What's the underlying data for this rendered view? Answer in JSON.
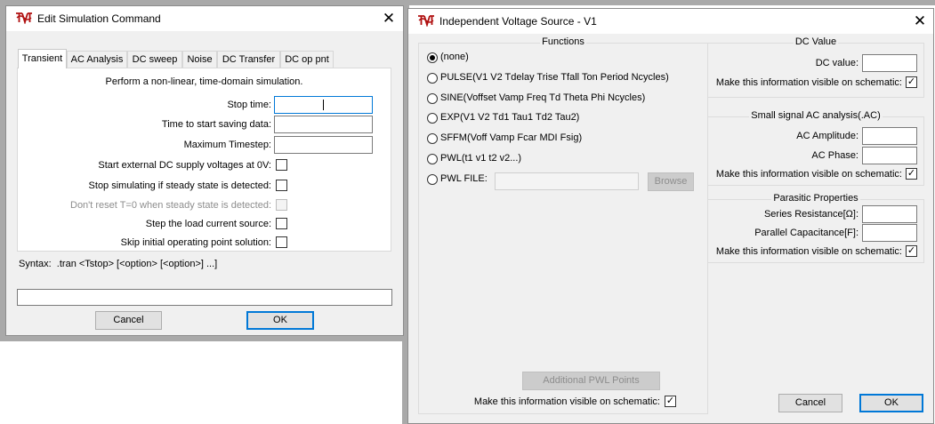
{
  "sim_dialog": {
    "title": "Edit Simulation Command",
    "tabs": [
      "Transient",
      "AC Analysis",
      "DC sweep",
      "Noise",
      "DC Transfer",
      "DC op pnt"
    ],
    "description": "Perform a non-linear, time-domain simulation.",
    "fields": {
      "stop_time": {
        "label": "Stop time:",
        "value": ""
      },
      "start_saving": {
        "label": "Time to start saving data:",
        "value": ""
      },
      "max_timestep": {
        "label": "Maximum Timestep:",
        "value": ""
      }
    },
    "options": {
      "start_ext_dc": {
        "label": "Start external DC supply voltages at 0V:",
        "checked": false
      },
      "stop_steady": {
        "label": "Stop simulating if steady state is detected:",
        "checked": false
      },
      "dont_reset": {
        "label": "Don't reset T=0 when steady state is detected:",
        "checked": false
      },
      "step_load": {
        "label": "Step the load current source:",
        "checked": false
      },
      "skip_op": {
        "label": "Skip initial operating point solution:",
        "checked": false
      }
    },
    "syntax": "Syntax:  .tran <Tstop> [<option> [<option>] ...]",
    "command_value": "",
    "cancel_label": "Cancel",
    "ok_label": "OK"
  },
  "vs_dialog": {
    "title": "Independent Voltage Source - V1",
    "functions": {
      "title": "Functions",
      "options": [
        {
          "label": "(none)",
          "selected": true
        },
        {
          "label": "PULSE(V1 V2 Tdelay Trise Tfall Ton Period Ncycles)",
          "selected": false
        },
        {
          "label": "SINE(Voffset Vamp Freq Td Theta Phi Ncycles)",
          "selected": false
        },
        {
          "label": "EXP(V1 V2 Td1 Tau1 Td2 Tau2)",
          "selected": false
        },
        {
          "label": "SFFM(Voff Vamp Fcar MDI Fsig)",
          "selected": false
        },
        {
          "label": "PWL(t1 v1 t2 v2...)",
          "selected": false
        },
        {
          "label": "PWL FILE:",
          "selected": false
        }
      ],
      "pwl_file_value": "",
      "browse_label": "Browse",
      "additional_pwl_label": "Additional PWL Points",
      "visible_label": "Make this information visible on schematic:",
      "visible_checked": true
    },
    "dc_value": {
      "title": "DC Value",
      "dc_label": "DC value:",
      "dc_value": "",
      "visible_label": "Make this information visible on schematic:",
      "visible_checked": true
    },
    "small_signal": {
      "title": "Small signal AC analysis(.AC)",
      "amp_label": "AC Amplitude:",
      "amp_value": "",
      "phase_label": "AC Phase:",
      "phase_value": "",
      "visible_label": "Make this information visible on schematic:",
      "visible_checked": true
    },
    "parasitic": {
      "title": "Parasitic Properties",
      "series_label": "Series Resistance[Ω]:",
      "series_value": "",
      "cap_label": "Parallel Capacitance[F]:",
      "cap_value": "",
      "visible_label": "Make this information visible on schematic:",
      "visible_checked": true
    },
    "cancel_label": "Cancel",
    "ok_label": "OK"
  },
  "colors": {
    "accent": "#0078d7",
    "dialog_bg": "#f0f0f0",
    "backdrop": "#a9a9a9"
  }
}
